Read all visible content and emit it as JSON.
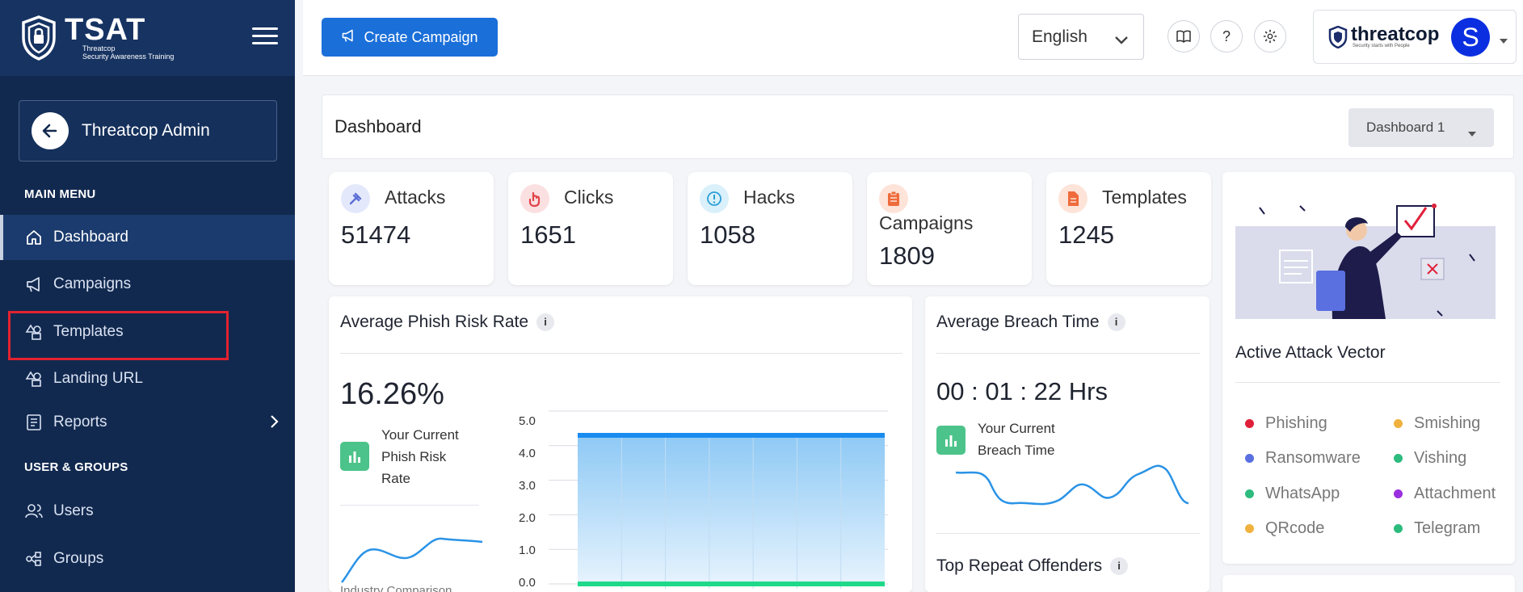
{
  "brand": {
    "name": "TSAT",
    "sub1": "Threatcop",
    "sub2": "Security Awareness Training"
  },
  "sidebar": {
    "admin_label": "Threatcop Admin",
    "main_menu_heading": "MAIN MENU",
    "items": [
      {
        "label": "Dashboard"
      },
      {
        "label": "Campaigns"
      },
      {
        "label": "Templates"
      },
      {
        "label": "Landing URL"
      },
      {
        "label": "Reports"
      }
    ],
    "users_heading": "USER & GROUPS",
    "user_items": [
      {
        "label": "Users"
      },
      {
        "label": "Groups"
      }
    ]
  },
  "header": {
    "create_label": "Create Campaign",
    "language": "English",
    "company_logo_text": "threatcop",
    "company_tagline": "Security starts with People",
    "avatar_initial": "S"
  },
  "titlebar": {
    "title": "Dashboard",
    "dashboard_select": "Dashboard 1"
  },
  "stats": [
    {
      "label": "Attacks",
      "value": "51474",
      "color": "#5b6fd6",
      "bg": "#e3e8fb"
    },
    {
      "label": "Clicks",
      "value": "1651",
      "color": "#e0434a",
      "bg": "#fbe0e1"
    },
    {
      "label": "Hacks",
      "value": "1058",
      "color": "#2a9fd8",
      "bg": "#daf0fb"
    },
    {
      "label": "Campaigns",
      "value": "1809",
      "color": "#ef6b3b",
      "bg": "#fde3d8"
    },
    {
      "label": "Templates",
      "value": "1245",
      "color": "#ef6b3b",
      "bg": "#fde3d8"
    }
  ],
  "phish": {
    "title": "Average Phish Risk Rate",
    "info": "i",
    "value": "16.26%",
    "line1": "Your Current",
    "line2": "Phish Risk",
    "line3": "Rate",
    "footer": "Industry Comparison"
  },
  "breach": {
    "title": "Average Breach Time",
    "info": "i",
    "value": "00 : 01 : 22 Hrs",
    "line1": "Your Current",
    "line2": "Breach Time",
    "offenders_title": "Top Repeat Offenders"
  },
  "chart_data": {
    "type": "area",
    "title": "",
    "xlabel": "",
    "ylabel": "",
    "ylim": [
      0,
      5
    ],
    "yticks": [
      "5.0",
      "4.0",
      "3.0",
      "2.0",
      "1.0",
      "0.0"
    ],
    "series": [
      {
        "name": "",
        "values": [
          4.3,
          4.3,
          4.3,
          4.3,
          4.3,
          4.3,
          4.3,
          4.3
        ],
        "color": "#1a8cf0"
      },
      {
        "name": "",
        "values": [
          0,
          0,
          0,
          0,
          0,
          0,
          0,
          0
        ],
        "color": "#1fd98a"
      }
    ],
    "grid": true
  },
  "vector": {
    "title": "Active Attack Vector",
    "items": [
      {
        "label": "Phishing",
        "color": "#e0203a"
      },
      {
        "label": "Smishing",
        "color": "#f0b13e"
      },
      {
        "label": "Ransomware",
        "color": "#5a6fe0"
      },
      {
        "label": "Vishing",
        "color": "#2dbb7e"
      },
      {
        "label": "WhatsApp",
        "color": "#2dbb7e"
      },
      {
        "label": "Attachment",
        "color": "#9a2fe0"
      },
      {
        "label": "QRcode",
        "color": "#f0b13e"
      },
      {
        "label": "Telegram",
        "color": "#2dbb7e"
      }
    ]
  }
}
